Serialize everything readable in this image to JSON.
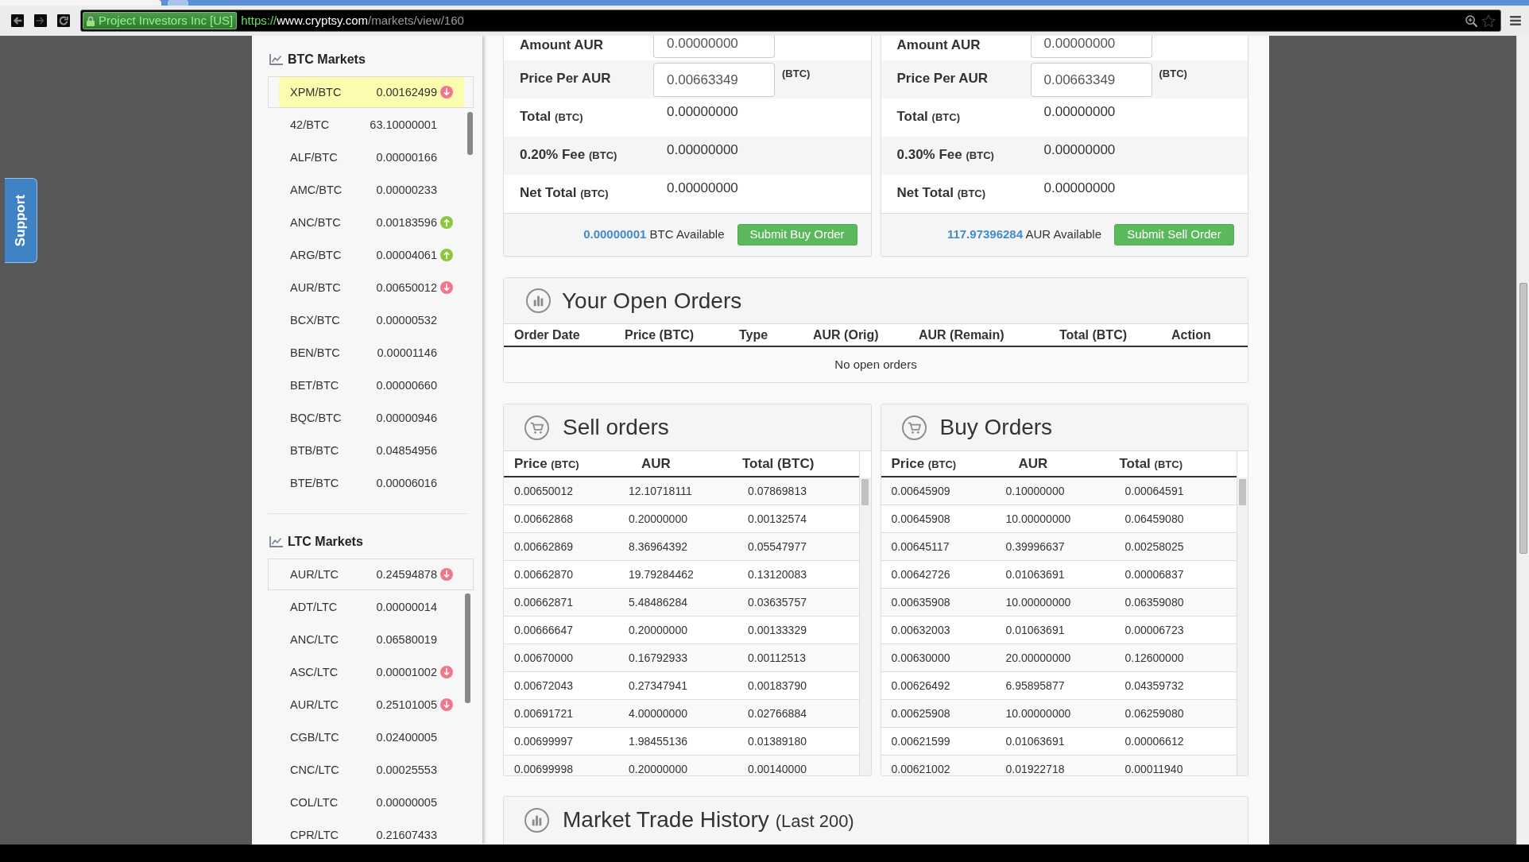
{
  "browser": {
    "address_bar": {
      "ev_badge": "Project Investors Inc [US]",
      "scheme": "https://",
      "host": "www.cryptsy.com",
      "path": "/markets/view/160"
    }
  },
  "support_tab": {
    "label": "Support"
  },
  "sidebar": {
    "sections": [
      {
        "title": "BTC Markets",
        "pinned": {
          "pair": "XPM/BTC",
          "price": "0.00162499",
          "rising": false,
          "highlighted": true
        },
        "markets": [
          {
            "pair": "42/BTC",
            "price": "63.10000001"
          },
          {
            "pair": "ALF/BTC",
            "price": "0.00000166"
          },
          {
            "pair": "AMC/BTC",
            "price": "0.00000233"
          },
          {
            "pair": "ANC/BTC",
            "price": "0.00183596",
            "rising": true
          },
          {
            "pair": "ARG/BTC",
            "price": "0.00004061",
            "rising": true
          },
          {
            "pair": "AUR/BTC",
            "price": "0.00650012",
            "rising": false
          },
          {
            "pair": "BCX/BTC",
            "price": "0.00000532"
          },
          {
            "pair": "BEN/BTC",
            "price": "0.00001146"
          },
          {
            "pair": "BET/BTC",
            "price": "0.00000660"
          },
          {
            "pair": "BQC/BTC",
            "price": "0.00000946"
          },
          {
            "pair": "BTB/BTC",
            "price": "0.04854956"
          },
          {
            "pair": "BTE/BTC",
            "price": "0.00006016"
          }
        ]
      },
      {
        "title": "LTC Markets",
        "pinned": {
          "pair": "AUR/LTC",
          "price": "0.24594878",
          "rising": false,
          "highlighted": false
        },
        "markets": [
          {
            "pair": "ADT/LTC",
            "price": "0.00000014"
          },
          {
            "pair": "ANC/LTC",
            "price": "0.06580019"
          },
          {
            "pair": "ASC/LTC",
            "price": "0.00001002",
            "rising": false
          },
          {
            "pair": "AUR/LTC",
            "price": "0.25101005",
            "rising": false
          },
          {
            "pair": "CGB/LTC",
            "price": "0.02400005"
          },
          {
            "pair": "CNC/LTC",
            "price": "0.00025553"
          },
          {
            "pair": "COL/LTC",
            "price": "0.00000005"
          },
          {
            "pair": "CPR/LTC",
            "price": "0.21607433"
          }
        ]
      }
    ]
  },
  "trade_forms": [
    {
      "rows": [
        {
          "kind": "input",
          "label": "Amount AUR",
          "value": "0.00000000"
        },
        {
          "kind": "input",
          "label": "Price Per AUR",
          "value": "0.00663349",
          "suffix": "(BTC)"
        },
        {
          "kind": "readout",
          "label": "Total",
          "unit": "(BTC)",
          "value": "0.00000000"
        },
        {
          "kind": "readout",
          "label": "0.20% Fee",
          "unit": "(BTC)",
          "value": "0.00000000"
        },
        {
          "kind": "readout",
          "label": "Net Total",
          "unit": "(BTC)",
          "value": "0.00000000"
        }
      ],
      "available": {
        "amount": "0.00000001",
        "label": "BTC Available"
      },
      "button": "Submit Buy Order"
    },
    {
      "rows": [
        {
          "kind": "input",
          "label": "Amount AUR",
          "value": "0.00000000"
        },
        {
          "kind": "input",
          "label": "Price Per AUR",
          "value": "0.00663349",
          "suffix": "(BTC)"
        },
        {
          "kind": "readout",
          "label": "Total",
          "unit": "(BTC)",
          "value": "0.00000000"
        },
        {
          "kind": "readout",
          "label": "0.30% Fee",
          "unit": "(BTC)",
          "value": "0.00000000"
        },
        {
          "kind": "readout",
          "label": "Net Total",
          "unit": "(BTC)",
          "value": "0.00000000"
        }
      ],
      "available": {
        "amount": "117.97396284",
        "label": "AUR Available"
      },
      "button": "Submit Sell Order"
    }
  ],
  "open_orders": {
    "title": "Your Open Orders",
    "columns": [
      "Order Date",
      "Price (BTC)",
      "Type",
      "AUR (Orig)",
      "AUR (Remain)",
      "Total (BTC)",
      "Action"
    ],
    "empty_message": "No open orders"
  },
  "order_books": [
    {
      "title": "Sell orders",
      "columns": [
        {
          "label": "Price",
          "unit": "(BTC)"
        },
        {
          "label": "AUR"
        },
        {
          "label": "Total (BTC)"
        }
      ],
      "rows": [
        [
          "0.00650012",
          "12.10718111",
          "0.07869813"
        ],
        [
          "0.00662868",
          "0.20000000",
          "0.00132574"
        ],
        [
          "0.00662869",
          "8.36964392",
          "0.05547977"
        ],
        [
          "0.00662870",
          "19.79284462",
          "0.13120083"
        ],
        [
          "0.00662871",
          "5.48486284",
          "0.03635757"
        ],
        [
          "0.00666647",
          "0.20000000",
          "0.00133329"
        ],
        [
          "0.00670000",
          "0.16792933",
          "0.00112513"
        ],
        [
          "0.00672043",
          "0.27347941",
          "0.00183790"
        ],
        [
          "0.00691721",
          "4.00000000",
          "0.02766884"
        ],
        [
          "0.00699997",
          "1.98455136",
          "0.01389180"
        ],
        [
          "0.00699998",
          "0.20000000",
          "0.00140000"
        ]
      ]
    },
    {
      "title": "Buy Orders",
      "columns": [
        {
          "label": "Price",
          "unit": "(BTC)"
        },
        {
          "label": "AUR"
        },
        {
          "label": "Total",
          "unit": "(BTC)"
        }
      ],
      "rows": [
        [
          "0.00645909",
          "0.10000000",
          "0.00064591"
        ],
        [
          "0.00645908",
          "10.00000000",
          "0.06459080"
        ],
        [
          "0.00645117",
          "0.39996637",
          "0.00258025"
        ],
        [
          "0.00642726",
          "0.01063691",
          "0.00006837"
        ],
        [
          "0.00635908",
          "10.00000000",
          "0.06359080"
        ],
        [
          "0.00632003",
          "0.01063691",
          "0.00006723"
        ],
        [
          "0.00630000",
          "20.00000000",
          "0.12600000"
        ],
        [
          "0.00626492",
          "6.95895877",
          "0.04359732"
        ],
        [
          "0.00625908",
          "10.00000000",
          "0.06259080"
        ],
        [
          "0.00621599",
          "0.01063691",
          "0.00006612"
        ],
        [
          "0.00621002",
          "0.01922718",
          "0.00011940"
        ]
      ]
    }
  ],
  "trade_history": {
    "title": "Market Trade History",
    "subtitle": "(Last 200)"
  }
}
